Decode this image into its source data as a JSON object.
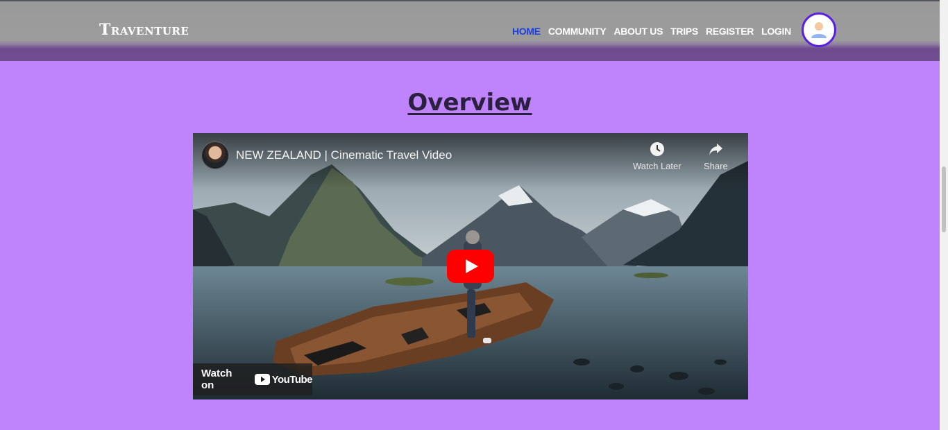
{
  "brand": "Traventure",
  "nav": {
    "items": [
      {
        "label": "HOME",
        "active": true
      },
      {
        "label": "COMMUNITY",
        "active": false
      },
      {
        "label": "ABOUT US",
        "active": false
      },
      {
        "label": "TRIPS",
        "active": false
      },
      {
        "label": "REGISTER",
        "active": false
      },
      {
        "label": "LOGIN",
        "active": false
      }
    ],
    "avatar_icon": "user-avatar-icon"
  },
  "overview": {
    "title": "Overview"
  },
  "video": {
    "title": "NEW ZEALAND | Cinematic Travel Video",
    "watch_later": "Watch Later",
    "share": "Share",
    "watch_on": "Watch on",
    "youtube": "YouTube"
  },
  "colors": {
    "page_bg": "#bf84fc",
    "nav_active": "#1a3fe0",
    "avatar_border": "#5a1fe0",
    "play_red": "#ff0000"
  }
}
